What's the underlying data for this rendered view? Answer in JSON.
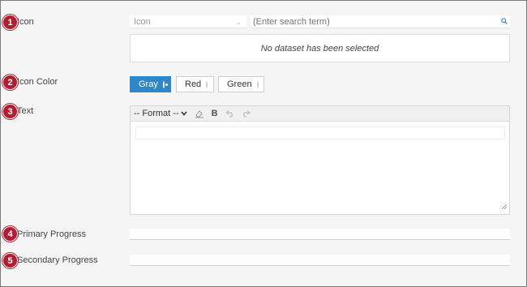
{
  "fields": {
    "icon": {
      "number": "1",
      "label": "Icon"
    },
    "icon_color": {
      "number": "2",
      "label": "Icon Color"
    },
    "text": {
      "number": "3",
      "label": "Text"
    },
    "primary_progress": {
      "number": "4",
      "label": "Primary Progress"
    },
    "secondary_progress": {
      "number": "5",
      "label": "Secondary Progress"
    }
  },
  "icon_select": {
    "value": "Icon"
  },
  "search": {
    "placeholder": "(Enter search term)"
  },
  "dataset": {
    "message": "No dataset has been selected"
  },
  "colors": {
    "options": [
      {
        "label": "Gray",
        "selected": true
      },
      {
        "label": "Red",
        "selected": false
      },
      {
        "label": "Green",
        "selected": false
      }
    ],
    "accent": "#2f86c8",
    "badge": "#b01e32"
  },
  "editor": {
    "format_label": "-- Format --",
    "bold_label": "B"
  }
}
